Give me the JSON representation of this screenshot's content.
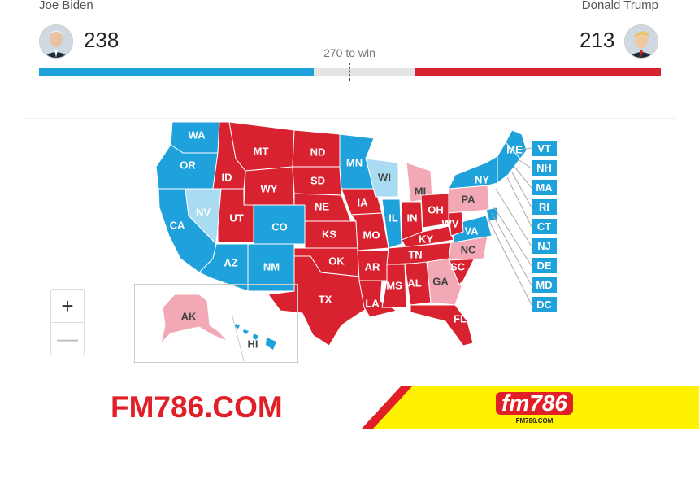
{
  "header": {
    "candidate_left": {
      "name": "Joe Biden",
      "votes": "238",
      "color": "#1fa2dc"
    },
    "candidate_right": {
      "name": "Donald Trump",
      "votes": "213",
      "color": "#d8222f"
    },
    "threshold_label": "270 to win",
    "progress": {
      "left_votes": 238,
      "right_votes": 213,
      "total": 538,
      "threshold": 270
    }
  },
  "colors": {
    "dem_called": "#1fa2dc",
    "rep_called": "#d8222f",
    "dem_leading": "#a9dcf3",
    "rep_leading": "#f2a9b5",
    "neutral": "#e4e4e4"
  },
  "map": {
    "states": [
      "WA",
      "OR",
      "CA",
      "NV",
      "ID",
      "MT",
      "WY",
      "UT",
      "CO",
      "AZ",
      "NM",
      "ND",
      "SD",
      "NE",
      "KS",
      "OK",
      "TX",
      "MN",
      "IA",
      "MO",
      "AR",
      "LA",
      "WI",
      "IL",
      "MI",
      "IN",
      "OH",
      "KY",
      "TN",
      "MS",
      "AL",
      "GA",
      "FL",
      "SC",
      "NC",
      "VA",
      "WV",
      "PA",
      "NY",
      "ME",
      "AK",
      "HI"
    ],
    "small_states": [
      "VT",
      "NH",
      "MA",
      "RI",
      "CT",
      "NJ",
      "DE",
      "MD",
      "DC"
    ]
  },
  "zoom": {
    "in_label": "+",
    "out_label": "—"
  },
  "watermark": {
    "text": "FM786.COM",
    "logo": "fm786",
    "logo_sub": "FM786.COM"
  }
}
